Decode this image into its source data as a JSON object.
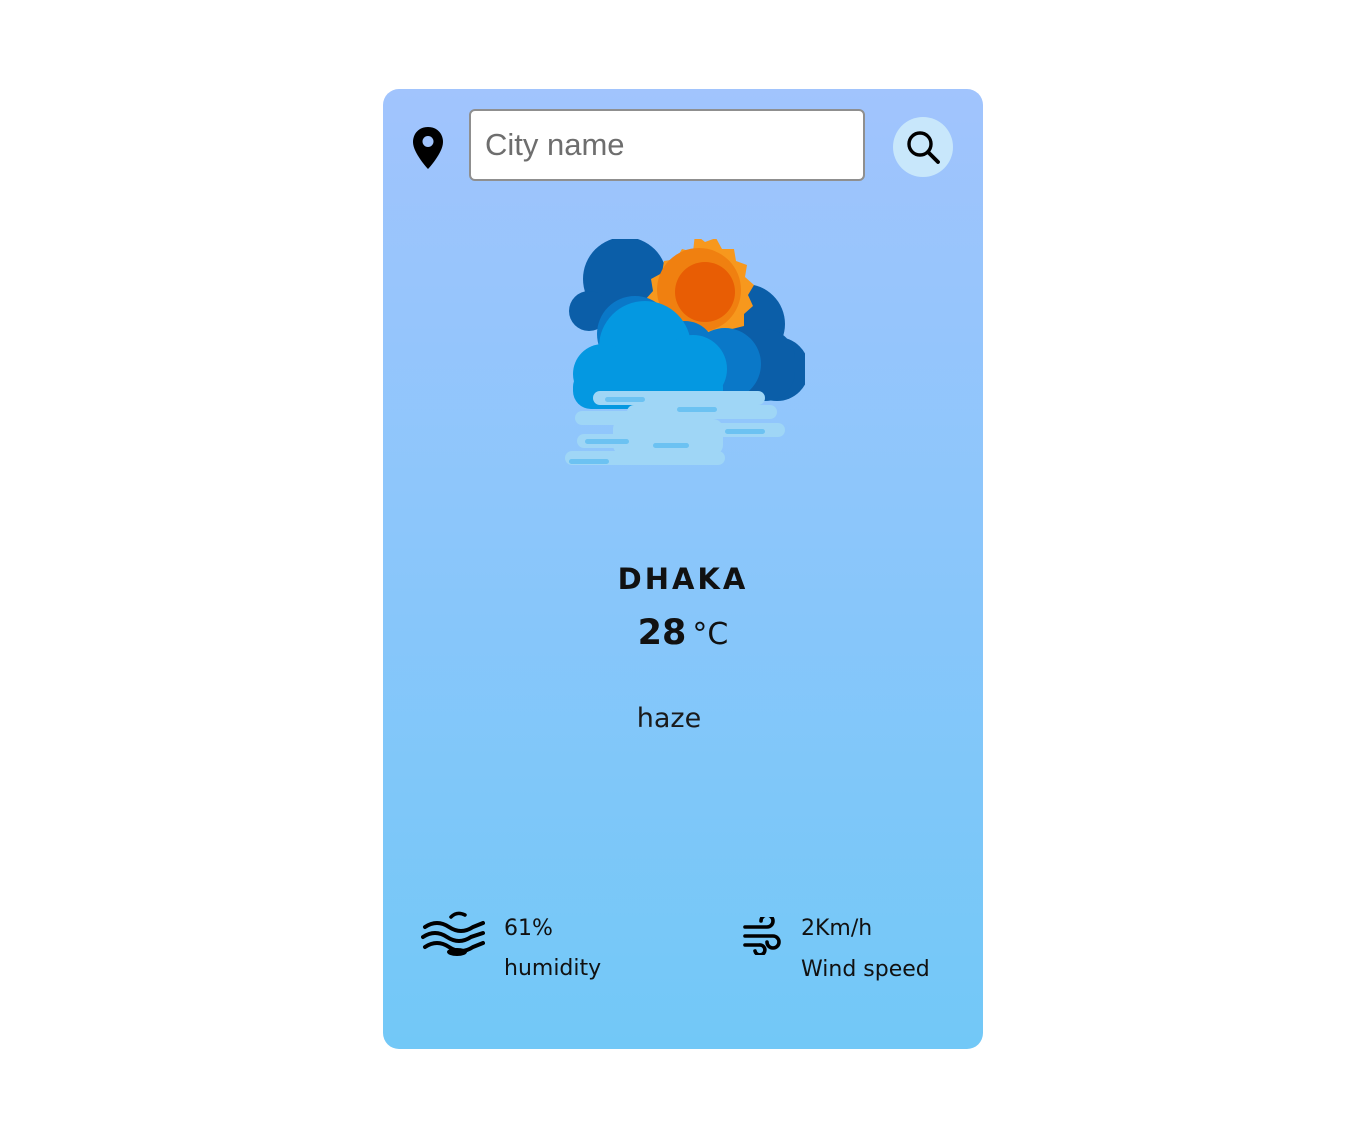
{
  "search": {
    "placeholder": "City name",
    "value": ""
  },
  "icons": {
    "location": "map-pin-icon",
    "search": "magnifier-icon",
    "weather": "haze-cloud-sun-icon",
    "humidity": "humidity-waves-icon",
    "wind": "wind-icon"
  },
  "weather": {
    "city": "DHAKA",
    "temperature": "28",
    "unit": "°C",
    "description": "haze"
  },
  "details": {
    "humidity_value": "61%",
    "humidity_label": "humidity",
    "wind_value": "2Km/h",
    "wind_label": "Wind speed"
  },
  "colors": {
    "card_top": "#a1c4fd",
    "card_bottom": "#72c8f7",
    "search_button": "#c8e7fb"
  }
}
